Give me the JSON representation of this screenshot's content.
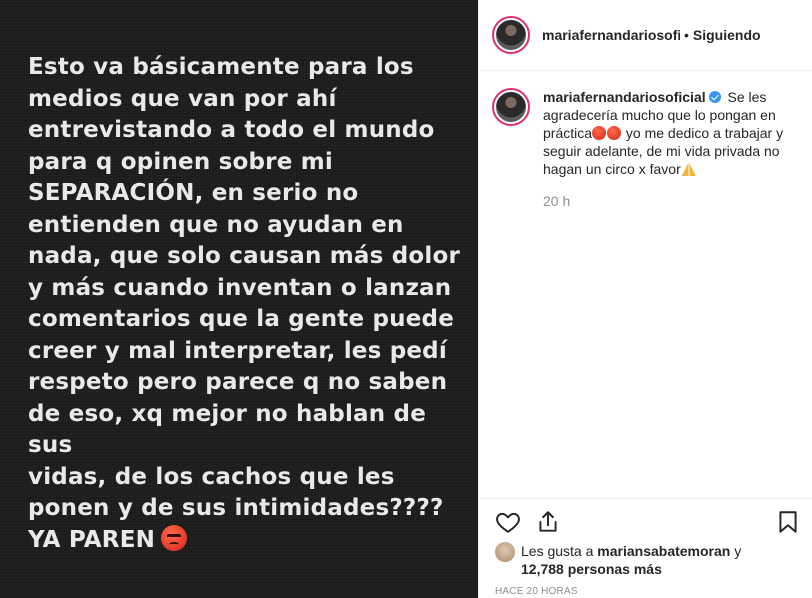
{
  "story": {
    "text": "Esto va básicamente para los\nmedios que van por ahí\nentrevistando a todo el mundo\npara q opinen sobre mi\nSEPARACIÓN, en serio no\nentienden que no ayudan en\nnada, que solo causan más dolor\ny más cuando inventan o lanzan\ncomentarios que la gente puede\ncreer y mal interpretar, les pedí\nrespeto pero parece q no saben\nde eso, xq mejor no hablan de sus\nvidas, de los cachos que les\nponen y de sus intimidades????\nYA PAREN",
    "emoji": "angry-face"
  },
  "header": {
    "username": "mariafernandariosofi",
    "separator": "•",
    "follow_state": "Siguiendo"
  },
  "caption": {
    "username": "mariafernandariosoficial",
    "text_part1": "Se les agradecería mucho que lo pongan en práctica",
    "text_part2": " yo me dedico a trabajar y seguir adelante, de mi vida privada no hagan un circo x favor",
    "time": "20 h"
  },
  "likes": {
    "prefix": "Les gusta a ",
    "user": "mariansabatemoran",
    "connector": " y",
    "count": "12,788 personas más"
  },
  "timestamp": "Hace 20 horas",
  "colors": {
    "accent": "#3897f0",
    "story_bg": "#1c1c1c",
    "ring": "#e1306c"
  }
}
